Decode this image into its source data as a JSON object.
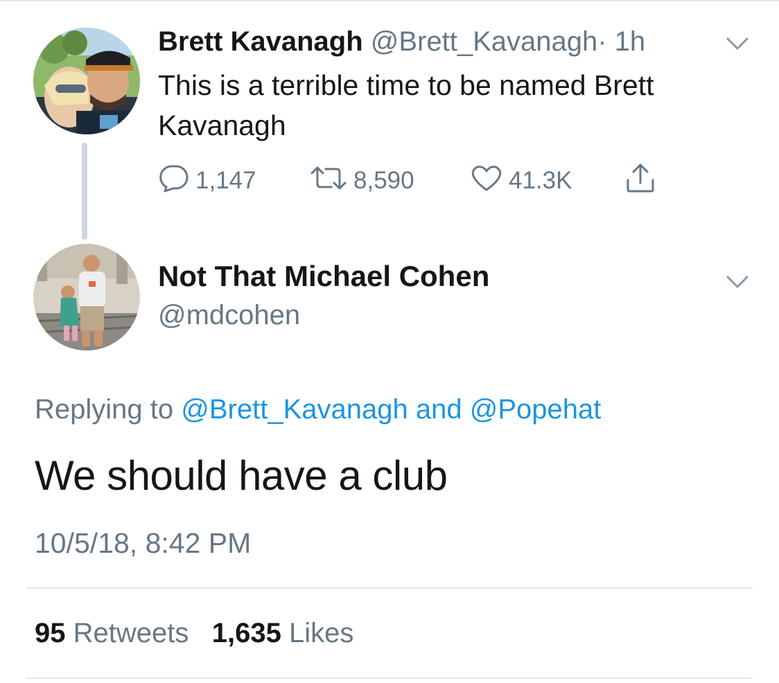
{
  "tweet1": {
    "author_name": "Brett Kavanagh",
    "handle": "@Brett_Kavanagh",
    "time": "· 1h",
    "text": "This is a terrible time to be named Brett Kavanagh",
    "replies": "1,147",
    "retweets": "8,590",
    "likes": "41.3K",
    "icons": {
      "reply": "reply-icon",
      "retweet": "retweet-icon",
      "like": "heart-icon",
      "share": "share-icon",
      "menu": "chevron-down-icon"
    }
  },
  "tweet2": {
    "author_name": "Not That Michael Cohen",
    "handle": "@mdcohen",
    "replying_prefix": "Replying to",
    "replying_mention1": "@Brett_Kavanagh",
    "replying_and": "and",
    "replying_mention2": "@Popehat",
    "text": "We should have a club",
    "timestamp": "10/5/18, 8:42 PM",
    "retweet_count": "95",
    "retweet_label": "Retweets",
    "like_count": "1,635",
    "like_label": "Likes"
  },
  "colors": {
    "text_primary": "#14171a",
    "text_secondary": "#657786",
    "link": "#1b95e0",
    "divider": "#e1e8ed",
    "thread_line": "#ccd6dd"
  }
}
